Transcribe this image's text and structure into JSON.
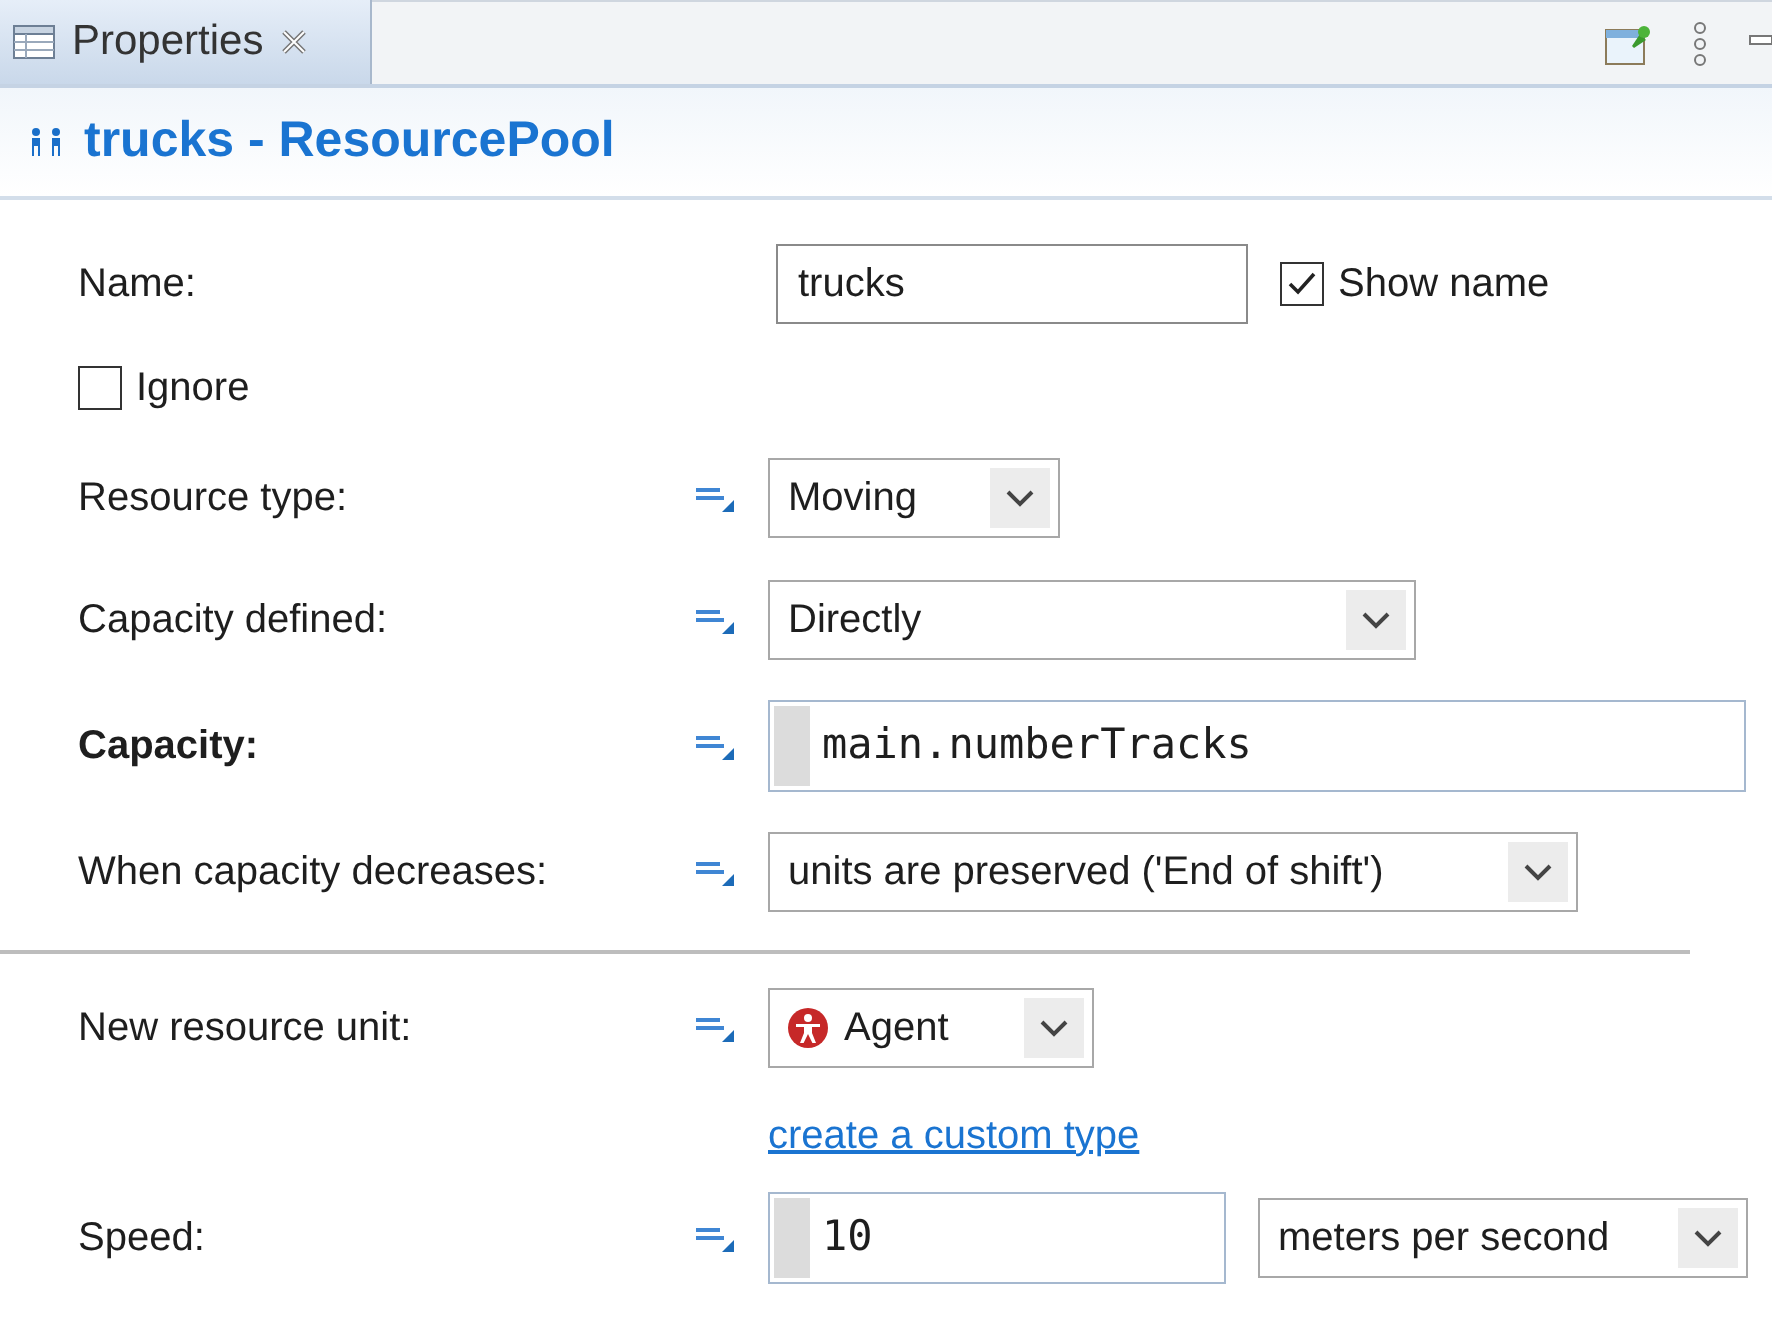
{
  "panel_tab": {
    "label": "Properties",
    "selected": true
  },
  "header": {
    "title": "trucks - ResourcePool"
  },
  "name_row": {
    "label": "Name:",
    "value": "trucks",
    "show_name": {
      "label": "Show name",
      "checked": true
    }
  },
  "ignore": {
    "label": "Ignore",
    "checked": false
  },
  "sections": [
    [
      {
        "kind": "dropdown",
        "label": "Resource type:",
        "value": "Moving",
        "bold": false
      },
      {
        "kind": "dropdown",
        "label": "Capacity defined:",
        "value": "Directly",
        "bold": false
      },
      {
        "kind": "code",
        "label": "Capacity:",
        "value": "main.numberTracks",
        "bold": true
      },
      {
        "kind": "dropdown",
        "label": "When capacity decreases:",
        "value": "units are preserved ('End of shift')",
        "bold": false
      }
    ],
    [
      {
        "kind": "type_dropdown",
        "label": "New resource unit:",
        "value": "Agent",
        "bold": false
      },
      {
        "kind": "link",
        "text": "create a custom type"
      },
      {
        "kind": "number_unit",
        "label": "Speed:",
        "value": "10",
        "unit": "meters per second",
        "bold": false
      }
    ]
  ]
}
